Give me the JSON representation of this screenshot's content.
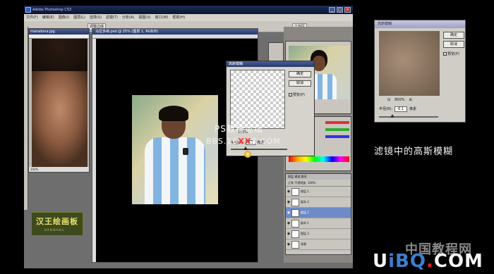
{
  "window": {
    "title": "Adobe Photoshop CS3"
  },
  "menus": [
    "文件(F)",
    "编辑(E)",
    "图像(I)",
    "图层(L)",
    "选择(S)",
    "滤镜(T)",
    "分析(A)",
    "视图(V)",
    "窗口(W)",
    "帮助(H)"
  ],
  "options": {
    "b1": "调整边缘",
    "b2": "工作区"
  },
  "doc_small": {
    "title": "maradona.jpg",
    "zoom": "100%"
  },
  "doc_main": {
    "title": "马拉多纳.psd @ 25% (图层 1, RGB/8)"
  },
  "logo": {
    "text": "汉王绘画板",
    "sub": "HANWANG"
  },
  "blur_dialog_small": {
    "title": "高斯模糊",
    "ok": "确定",
    "cancel": "取消",
    "preview": "预览(P)",
    "zoom": "100%",
    "radius_label": "半径(R):",
    "radius_value": "0.1",
    "unit": "像素"
  },
  "watermark": {
    "line1": "PS教程论坛",
    "line2a": "BBS.16",
    "line2b": "XX",
    "line2c": "8.COM"
  },
  "layers": {
    "tabs": "图层 通道 路径",
    "mode": "正常  不透明度: 100%",
    "rows": [
      "图层 1",
      "副本 2",
      "图层 2",
      "副本 1",
      "图层 3",
      "背景"
    ]
  },
  "blur_dialog": {
    "title": "高斯模糊",
    "ok": "确定",
    "cancel": "取消",
    "preview": "预览(P)",
    "zoom": "800%",
    "radius_label": "半径(R):",
    "radius_value": "6.1",
    "unit": "像素"
  },
  "caption": "滤镜中的高斯模糊",
  "site": {
    "cn": "中国教程网",
    "en_a": "U",
    "en_b": "iBQ",
    "en_c": ".",
    "en_d": "COM"
  }
}
